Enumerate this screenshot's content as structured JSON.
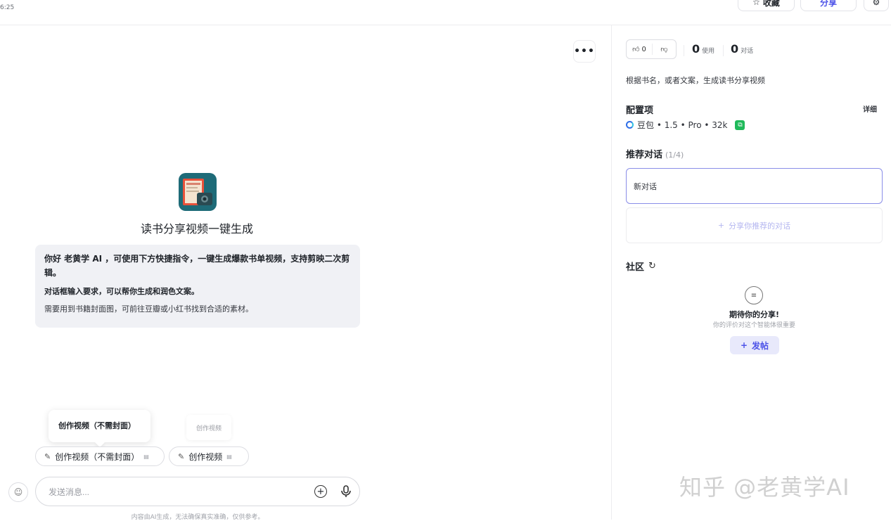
{
  "topbar": {
    "time": "6:25",
    "favorite_label": "收藏",
    "share_label": "分享"
  },
  "main": {
    "more_label": "•••",
    "bot_title": "读书分享视频一键生成",
    "welcome": {
      "line1": "你好 老黄学 AI ，可使用下方快捷指令，一键生成爆款书单视频，支持剪映二次剪辑。",
      "line2": "对话框输入要求，可以帮你生成和润色文案。",
      "line3": "需要用到书籍封面图，可前往豆瓣或小红书找到合适的素材。"
    },
    "tooltip": "创作视频（不需封面）",
    "ghost_chip": "创作视频",
    "chips": [
      {
        "label": "创作视频（不需封面）"
      },
      {
        "label": "创作视频"
      }
    ],
    "input_placeholder": "发送消息...",
    "disclaimer": "内容由AI生成，无法确保真实准确，仅供参考。"
  },
  "right": {
    "likes": "0",
    "uses_num": "0",
    "uses_label": "使用",
    "convs_num": "0",
    "convs_label": "对话",
    "description": "根据书名，或者文案，生成读书分享视频",
    "config_title": "配置项",
    "config_detail": "详细",
    "model": "豆包 • 1.5 • Pro • 32k",
    "recommend_title": "推荐对话",
    "recommend_count": "(1/4)",
    "recommend_item": "新对话",
    "recommend_add": "分享你推荐的对话",
    "community_title": "社区",
    "community_empty": "期待你的分享!",
    "community_sub": "你的评价对这个智能体很重要",
    "post_label": "发帖",
    "watermark": "知乎 @老黄学AI"
  }
}
